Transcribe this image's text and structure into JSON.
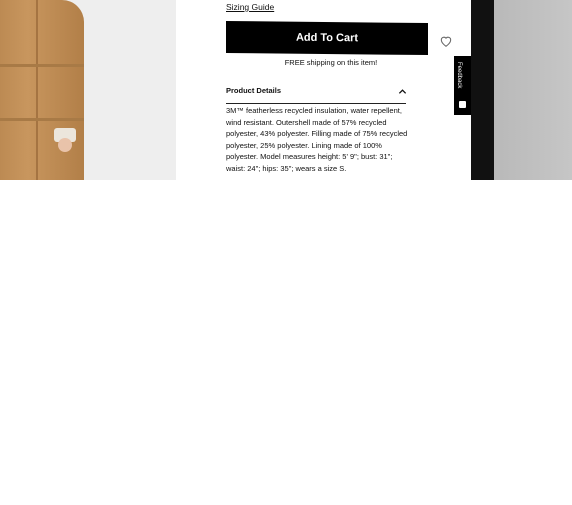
{
  "product": {
    "sizing_guide": "Sizing Guide",
    "add_to_cart": "Add To Cart",
    "shipping_note": "FREE shipping on this item!",
    "details_title": "Product Details",
    "details_text": "3M™ featherless recycled insulation, water repellent, wind resistant. Outershell made of 57% recycled polyester, 43% polyester. Filling made of 75% recycled polyester, 25% polyester. Lining made of 100% polyester. Model measures height: 5' 9\"; bust: 31\"; waist: 24\"; hips: 35\"; wears a size S."
  },
  "feedback": {
    "label": "Feedback"
  },
  "icons": {
    "wishlist": "heart-icon",
    "collapse": "chevron-up-icon",
    "feedback": "feedback-icon"
  },
  "colors": {
    "button_bg": "#000000",
    "coat": "#c08d56"
  }
}
